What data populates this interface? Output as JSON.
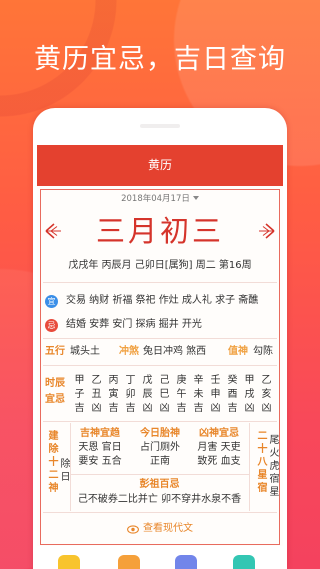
{
  "promo": {
    "headline": "黄历宜忌，吉日查询"
  },
  "header": {
    "title": "黄历"
  },
  "date_picker": {
    "value": "2018年04月17日",
    "icon": "chevron-down-icon"
  },
  "lunar": {
    "date": "三月初三",
    "prev_icon": "arrow-left-ornament-icon",
    "next_icon": "arrow-right-ornament-icon",
    "ganzhi": "戊戌年 丙辰月 己卯日[属狗] 周二 第16周"
  },
  "yi": {
    "badge": "宜",
    "items": "交易 纳财 祈福 祭祀 作灶 成人礼 求子 斋醮"
  },
  "ji": {
    "badge": "忌",
    "items": "结婚 安葬 安门 探病 掘井 开光"
  },
  "info": {
    "wuxing": {
      "label": "五行",
      "value": "城头土"
    },
    "chongsha": {
      "label": "冲煞",
      "value": "兔日冲鸡 煞西"
    },
    "zhishen": {
      "label": "值神",
      "value": "勾陈"
    }
  },
  "hours": {
    "label_top": "时辰",
    "label_bottom": "宜忌",
    "columns": [
      {
        "stem": "甲",
        "branch": "子",
        "luck": "吉"
      },
      {
        "stem": "乙",
        "branch": "丑",
        "luck": "凶"
      },
      {
        "stem": "丙",
        "branch": "寅",
        "luck": "吉"
      },
      {
        "stem": "丁",
        "branch": "卯",
        "luck": "吉"
      },
      {
        "stem": "戊",
        "branch": "辰",
        "luck": "凶"
      },
      {
        "stem": "己",
        "branch": "巳",
        "luck": "凶"
      },
      {
        "stem": "庚",
        "branch": "午",
        "luck": "吉"
      },
      {
        "stem": "辛",
        "branch": "未",
        "luck": "吉"
      },
      {
        "stem": "壬",
        "branch": "申",
        "luck": "凶"
      },
      {
        "stem": "癸",
        "branch": "酉",
        "luck": "吉"
      },
      {
        "stem": "甲",
        "branch": "戌",
        "luck": "凶"
      },
      {
        "stem": "乙",
        "branch": "亥",
        "luck": "凶"
      }
    ]
  },
  "jianchu": {
    "label": "建除十二神",
    "value": "除日"
  },
  "gods": [
    {
      "title": "吉神宜趋",
      "line1": "天恩 官日",
      "line2": "要安 五合"
    },
    {
      "title": "今日胎神",
      "line1": "占门厕外",
      "line2": "正南"
    },
    {
      "title": "凶神宜忌",
      "line1": "月害 天吏",
      "line2": "致死 血支"
    }
  ],
  "xingxiu": {
    "label": "二十八星宿",
    "value": "尾火虎宿星"
  },
  "pengzu": {
    "title": "彭祖百忌",
    "text": "己不破券二比并亡 卯不穿井水泉不香"
  },
  "modern_text_link": {
    "label": "查看现代文",
    "icon": "eye-icon"
  },
  "shortcuts": [
    {
      "icon": "app-shortcut-icon",
      "color": "#f8c42d"
    },
    {
      "icon": "app-shortcut-icon",
      "color": "#f5a03a"
    },
    {
      "icon": "app-shortcut-icon",
      "color": "#7285ea"
    },
    {
      "icon": "app-shortcut-icon",
      "color": "#33c6b3"
    }
  ],
  "colors": {
    "background_top": "#ff7538",
    "background_bottom": "#f4425e",
    "header": "#e4412f",
    "accent_red": "#d5342b",
    "label_orange": "#e8862a",
    "yi_badge": "#3b8fe8",
    "ji_badge": "#e84b3c"
  }
}
